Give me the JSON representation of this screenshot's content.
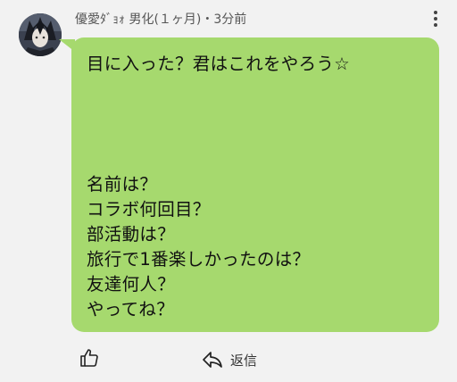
{
  "post": {
    "author": "優愛ﾀﾞｮｫ 男化(１ヶ月)",
    "separator": "・",
    "time": "3分前",
    "message_lines": [
      "目に入った？君はこれをやろう☆",
      "名前は？",
      "コラボ何回目？",
      "部活動は？",
      "旅行で1番楽しかったのは？",
      "友達何人？",
      "やってね？"
    ]
  },
  "actions": {
    "reply_label": "返信"
  },
  "icons": {
    "more": "more-vertical-icon",
    "like": "thumbs-up-icon",
    "reply": "reply-arrow-icon"
  },
  "colors": {
    "bubble": "#a6d96e",
    "background": "#f2f2f2"
  }
}
